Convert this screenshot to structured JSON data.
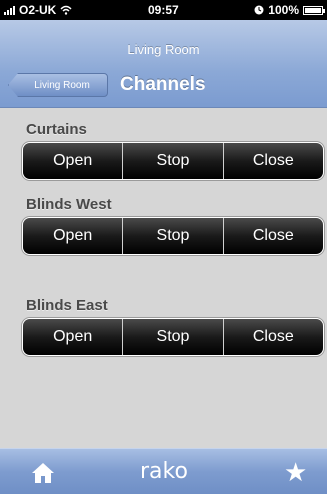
{
  "status_bar": {
    "carrier": "O2-UK",
    "time": "09:57",
    "battery": "100%",
    "battery_level": 1.0
  },
  "nav": {
    "subtitle": "Living Room",
    "back_label": "Living Room",
    "title": "Channels"
  },
  "groups": [
    {
      "label": "Curtains",
      "buttons": [
        "Open",
        "Stop",
        "Close"
      ]
    },
    {
      "label": "Blinds West",
      "buttons": [
        "Open",
        "Stop",
        "Close"
      ]
    },
    {
      "label": "Blinds East",
      "buttons": [
        "Open",
        "Stop",
        "Close"
      ]
    }
  ],
  "tab_bar": {
    "logo": "rako",
    "icons": [
      "home-icon",
      "star-icon"
    ]
  },
  "colors": {
    "nav_blue": "#8ba8d6",
    "button_black": "#000000",
    "background": "#d6d6d6"
  }
}
